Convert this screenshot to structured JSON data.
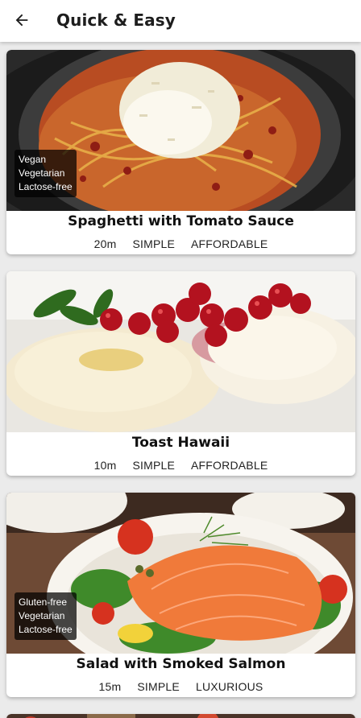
{
  "app_bar": {
    "title": "Quick & Easy",
    "back_icon": "arrow-left-icon"
  },
  "meals": [
    {
      "title": "Spaghetti with Tomato Sauce",
      "duration": "20m",
      "complexity": "SIMPLE",
      "affordability": "AFFORDABLE",
      "tags": [
        "Vegan",
        "Vegetarian",
        "Lactose-free"
      ]
    },
    {
      "title": "Toast Hawaii",
      "duration": "10m",
      "complexity": "SIMPLE",
      "affordability": "AFFORDABLE",
      "tags": []
    },
    {
      "title": "Salad with Smoked Salmon",
      "duration": "15m",
      "complexity": "SIMPLE",
      "affordability": "LUXURIOUS",
      "tags": [
        "Gluten-free",
        "Vegetarian",
        "Lactose-free"
      ]
    }
  ],
  "colors": {
    "app_bar_bg": "#ffffff",
    "page_bg": "#ebebeb",
    "tag_bg": "rgba(0,0,0,0.72)"
  }
}
